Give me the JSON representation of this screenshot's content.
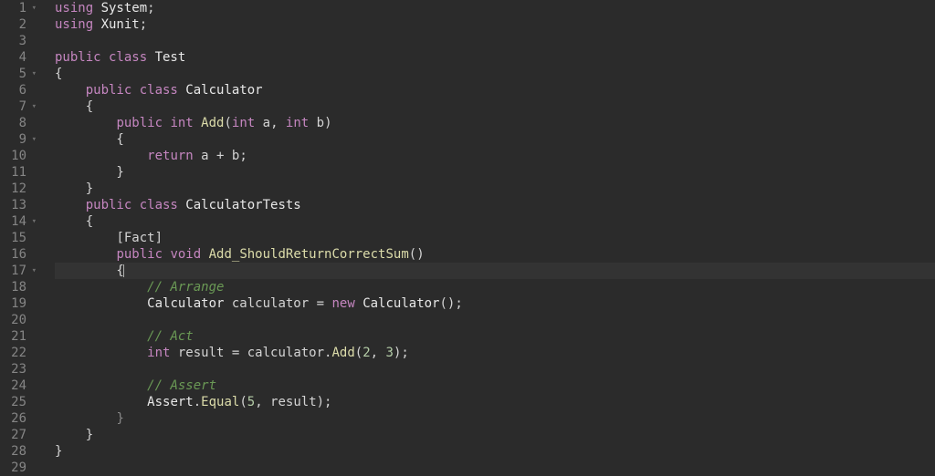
{
  "editor": {
    "highlighted_line": 17,
    "lines": [
      {
        "n": 1,
        "fold": "▾",
        "tokens": [
          {
            "t": "using ",
            "c": "kw"
          },
          {
            "t": "System",
            "c": "cls"
          },
          {
            "t": ";",
            "c": "op"
          }
        ]
      },
      {
        "n": 2,
        "tokens": [
          {
            "t": "using ",
            "c": "kw"
          },
          {
            "t": "Xunit",
            "c": "cls"
          },
          {
            "t": ";",
            "c": "op"
          }
        ]
      },
      {
        "n": 3,
        "tokens": [
          {
            "t": "",
            "c": ""
          }
        ]
      },
      {
        "n": 4,
        "tokens": [
          {
            "t": "public class ",
            "c": "kw"
          },
          {
            "t": "Test",
            "c": "cls"
          }
        ]
      },
      {
        "n": 5,
        "fold": "▾",
        "tokens": [
          {
            "t": "{",
            "c": "op"
          }
        ]
      },
      {
        "n": 6,
        "tokens": [
          {
            "t": "    ",
            "c": ""
          },
          {
            "t": "public class ",
            "c": "kw"
          },
          {
            "t": "Calculator",
            "c": "cls"
          }
        ]
      },
      {
        "n": 7,
        "fold": "▾",
        "tokens": [
          {
            "t": "    {",
            "c": "op"
          }
        ]
      },
      {
        "n": 8,
        "tokens": [
          {
            "t": "        ",
            "c": ""
          },
          {
            "t": "public ",
            "c": "kw"
          },
          {
            "t": "int ",
            "c": "kw"
          },
          {
            "t": "Add",
            "c": "id"
          },
          {
            "t": "(",
            "c": "op"
          },
          {
            "t": "int ",
            "c": "kw"
          },
          {
            "t": "a",
            "c": "nm"
          },
          {
            "t": ", ",
            "c": "op"
          },
          {
            "t": "int ",
            "c": "kw"
          },
          {
            "t": "b",
            "c": "nm"
          },
          {
            "t": ")",
            "c": "op"
          }
        ]
      },
      {
        "n": 9,
        "fold": "▾",
        "tokens": [
          {
            "t": "        {",
            "c": "op"
          }
        ]
      },
      {
        "n": 10,
        "tokens": [
          {
            "t": "            ",
            "c": ""
          },
          {
            "t": "return ",
            "c": "kw"
          },
          {
            "t": "a ",
            "c": "nm"
          },
          {
            "t": "+",
            "c": "op"
          },
          {
            "t": " b",
            "c": "nm"
          },
          {
            "t": ";",
            "c": "op"
          }
        ]
      },
      {
        "n": 11,
        "tokens": [
          {
            "t": "        }",
            "c": "op"
          }
        ]
      },
      {
        "n": 12,
        "tokens": [
          {
            "t": "    }",
            "c": "op"
          }
        ]
      },
      {
        "n": 13,
        "tokens": [
          {
            "t": "    ",
            "c": ""
          },
          {
            "t": "public class ",
            "c": "kw"
          },
          {
            "t": "CalculatorTests",
            "c": "cls"
          }
        ]
      },
      {
        "n": 14,
        "fold": "▾",
        "tokens": [
          {
            "t": "    {",
            "c": "op"
          }
        ]
      },
      {
        "n": 15,
        "tokens": [
          {
            "t": "        ",
            "c": ""
          },
          {
            "t": "[",
            "c": "op"
          },
          {
            "t": "Fact",
            "c": "attr"
          },
          {
            "t": "]",
            "c": "op"
          }
        ]
      },
      {
        "n": 16,
        "tokens": [
          {
            "t": "        ",
            "c": ""
          },
          {
            "t": "public ",
            "c": "kw"
          },
          {
            "t": "void ",
            "c": "kw"
          },
          {
            "t": "Add_ShouldReturnCorrectSum",
            "c": "id"
          },
          {
            "t": "()",
            "c": "op"
          }
        ]
      },
      {
        "n": 17,
        "fold": "▾",
        "tokens": [
          {
            "t": "        {",
            "c": "op"
          }
        ],
        "caret": true
      },
      {
        "n": 18,
        "tokens": [
          {
            "t": "            ",
            "c": ""
          },
          {
            "t": "// Arrange",
            "c": "cm"
          }
        ]
      },
      {
        "n": 19,
        "tokens": [
          {
            "t": "            ",
            "c": ""
          },
          {
            "t": "Calculator",
            "c": "cls"
          },
          {
            "t": " calculator ",
            "c": "nm"
          },
          {
            "t": "=",
            "c": "op"
          },
          {
            "t": " ",
            "c": ""
          },
          {
            "t": "new ",
            "c": "kw"
          },
          {
            "t": "Calculator",
            "c": "cls"
          },
          {
            "t": "();",
            "c": "op"
          }
        ]
      },
      {
        "n": 20,
        "tokens": [
          {
            "t": "",
            "c": ""
          }
        ]
      },
      {
        "n": 21,
        "tokens": [
          {
            "t": "            ",
            "c": ""
          },
          {
            "t": "// Act",
            "c": "cm"
          }
        ]
      },
      {
        "n": 22,
        "tokens": [
          {
            "t": "            ",
            "c": ""
          },
          {
            "t": "int ",
            "c": "kw"
          },
          {
            "t": "result ",
            "c": "nm"
          },
          {
            "t": "=",
            "c": "op"
          },
          {
            "t": " calculator",
            "c": "nm"
          },
          {
            "t": ".",
            "c": "op"
          },
          {
            "t": "Add",
            "c": "id"
          },
          {
            "t": "(",
            "c": "op"
          },
          {
            "t": "2",
            "c": "num"
          },
          {
            "t": ", ",
            "c": "op"
          },
          {
            "t": "3",
            "c": "num"
          },
          {
            "t": ");",
            "c": "op"
          }
        ]
      },
      {
        "n": 23,
        "tokens": [
          {
            "t": "",
            "c": ""
          }
        ]
      },
      {
        "n": 24,
        "tokens": [
          {
            "t": "            ",
            "c": ""
          },
          {
            "t": "// Assert",
            "c": "cm"
          }
        ]
      },
      {
        "n": 25,
        "tokens": [
          {
            "t": "            ",
            "c": ""
          },
          {
            "t": "Assert",
            "c": "cls"
          },
          {
            "t": ".",
            "c": "op"
          },
          {
            "t": "Equal",
            "c": "id"
          },
          {
            "t": "(",
            "c": "op"
          },
          {
            "t": "5",
            "c": "num"
          },
          {
            "t": ", result);",
            "c": "op"
          }
        ]
      },
      {
        "n": 26,
        "tokens": [
          {
            "t": "        ",
            "c": ""
          },
          {
            "t": "}",
            "c": "dim"
          }
        ]
      },
      {
        "n": 27,
        "tokens": [
          {
            "t": "    }",
            "c": "op"
          }
        ]
      },
      {
        "n": 28,
        "tokens": [
          {
            "t": "}",
            "c": "op"
          }
        ]
      },
      {
        "n": 29,
        "tokens": [
          {
            "t": "",
            "c": ""
          }
        ]
      }
    ]
  }
}
